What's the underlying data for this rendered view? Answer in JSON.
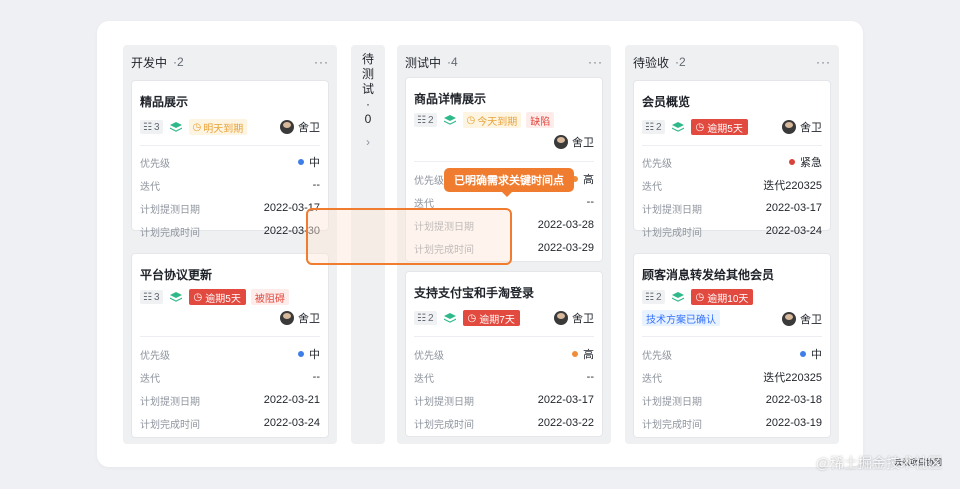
{
  "columns": {
    "dev": {
      "title": "开发中",
      "count": "·2",
      "more": "···"
    },
    "wait": {
      "chars": [
        "待",
        "测",
        "试",
        "·",
        "0"
      ],
      "chevron": "›"
    },
    "test": {
      "title": "测试中",
      "count": "·4",
      "more": "···"
    },
    "acc": {
      "title": "待验收",
      "count": "·2",
      "more": "···"
    }
  },
  "labels": {
    "priority": "优先级",
    "iteration": "迭代",
    "plan_test_date": "计划提测日期",
    "plan_done_time": "计划完成时间"
  },
  "cards": {
    "dev1": {
      "title": "精品展示",
      "sub": "3",
      "due": "明天到期",
      "assignee": "舍卫",
      "priority": "中",
      "iteration": "--",
      "test_date": "2022-03-17",
      "done_date": "2022-03-30"
    },
    "dev2": {
      "title": "平台协议更新",
      "sub": "3",
      "due": "逾期5天",
      "tag": "被阻碍",
      "assignee": "舍卫",
      "priority": "中",
      "iteration": "--",
      "test_date": "2022-03-21",
      "done_date": "2022-03-24"
    },
    "test1": {
      "title": "商品详情展示",
      "sub": "2",
      "due": "今天到期",
      "tag": "缺陷",
      "assignee": "舍卫",
      "priority": "高",
      "iteration": "--",
      "test_date": "2022-03-28",
      "done_date": "2022-03-29"
    },
    "test2": {
      "title": "支持支付宝和手淘登录",
      "sub": "2",
      "due": "逾期7天",
      "assignee": "舍卫",
      "priority": "高",
      "iteration": "--",
      "test_date": "2022-03-17",
      "done_date": "2022-03-22"
    },
    "acc1": {
      "title": "会员概览",
      "sub": "2",
      "due": "逾期5天",
      "assignee": "舍卫",
      "priority": "紧急",
      "iteration": "迭代220325",
      "test_date": "2022-03-17",
      "done_date": "2022-03-24"
    },
    "acc2": {
      "title": "顾客消息转发给其他会员",
      "sub": "2",
      "due": "逾期10天",
      "tag": "技术方案已确认",
      "assignee": "舍卫",
      "priority": "中",
      "iteration": "迭代220325",
      "test_date": "2022-03-18",
      "done_date": "2022-03-19"
    }
  },
  "tooltip": "已明确需求关键时间点",
  "watermark": "@稀土掘金技术社区",
  "watermark_sub": "云效项目协同",
  "colors": {
    "priority_mid": "#3f7ee8",
    "priority_high": "#f08d3a",
    "priority_urgent": "#d9423b",
    "accent": "#f07c30"
  }
}
